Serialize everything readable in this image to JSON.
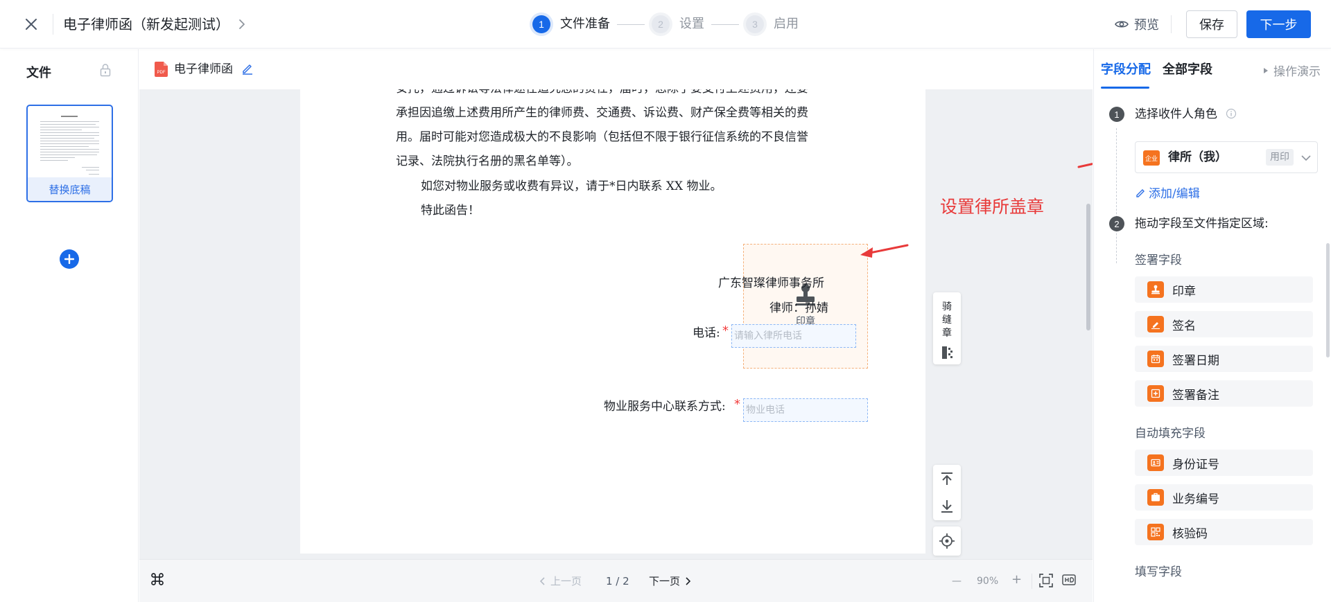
{
  "header": {
    "title": "电子律师函（新发起测试）",
    "steps": [
      {
        "num": "1",
        "label": "文件准备"
      },
      {
        "num": "2",
        "label": "设置"
      },
      {
        "num": "3",
        "label": "启用"
      }
    ],
    "preview_label": "预览",
    "save_label": "保存",
    "next_label": "下一步"
  },
  "left_panel": {
    "title": "文件",
    "replace_label": "替换底稿"
  },
  "file_bar": {
    "file_name": "电子律师函",
    "pdf_badge": "PDF"
  },
  "document": {
    "lines": [
      "安托，通过诉讼等法律途径追究您的责任，届时，您除了要支付上述费用，还要",
      "承担因追缴上述费用所产生的律师费、交通费、诉讼费、财产保全费等相关的费",
      "用。届时可能对您造成极大的不良影响（包括但不限于银行征信系统的不良信誉",
      "记录、法院执行名册的黑名单等）。",
      "如您对物业服务或收费有异议，请于*日内联系 XX 物业。",
      "特此函告！"
    ],
    "firm": "广东智璨律师事务所",
    "lawyer": "律师：孙婧",
    "phone_label": "电话:",
    "phone_placeholder": "请输入律所电话",
    "contact_label": "物业服务中心联系方式:",
    "contact_placeholder": "物业电话",
    "required_mark": "*",
    "seal_label": "印章"
  },
  "annotation": {
    "text": "设置律所盖章",
    "color": "#e83a3a"
  },
  "tools": {
    "seam_seal": "骑缝章"
  },
  "pagination": {
    "prev": "上一页",
    "current": "1 / 2",
    "next": "下一页",
    "zoom": "90%",
    "minus": "—",
    "plus": "+"
  },
  "right_panel": {
    "tabs": [
      "字段分配",
      "全部字段"
    ],
    "demo_link": "操作演示",
    "step1_num": "1",
    "step1_label": "选择收件人角色",
    "role": {
      "badge": "企业",
      "name": "律所（我）",
      "tag": "用印"
    },
    "add_edit": "添加/编辑",
    "step2_num": "2",
    "step2_label": "拖动字段至文件指定区域:",
    "groups": {
      "sign_title": "签署字段",
      "sign_fields": [
        "印章",
        "签名",
        "签署日期",
        "签署备注"
      ],
      "auto_title": "自动填充字段",
      "auto_fields": [
        "身份证号",
        "业务编号",
        "核验码"
      ],
      "fill_title": "填写字段"
    }
  },
  "colors": {
    "primary": "#1769e8",
    "field_icon": "#f5731f",
    "required": "#f23c3c"
  }
}
